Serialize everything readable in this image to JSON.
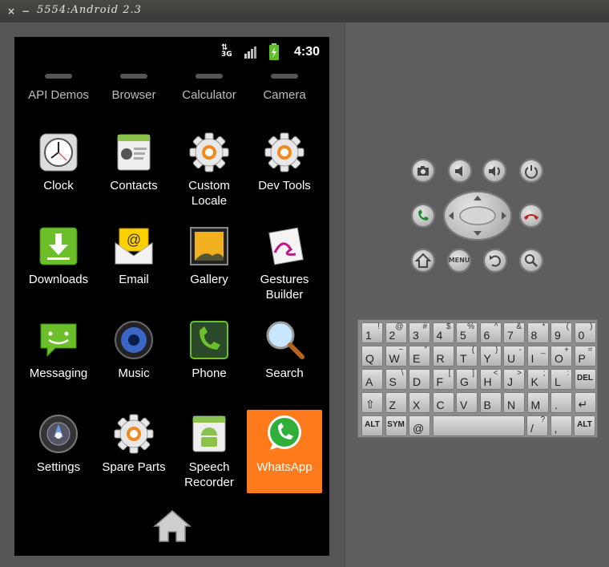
{
  "window": {
    "title": "5554:Android 2.3",
    "close_glyph": "×",
    "min_glyph": "−",
    "max_glyph": "□"
  },
  "status": {
    "time": "4:30",
    "network": "3G"
  },
  "partial_row": [
    "API Demos",
    "Browser",
    "Calculator",
    "Camera"
  ],
  "apps": [
    {
      "label": "Clock",
      "icon": "clock-icon"
    },
    {
      "label": "Contacts",
      "icon": "contacts-icon"
    },
    {
      "label": "Custom\nLocale",
      "icon": "gear-icon"
    },
    {
      "label": "Dev Tools",
      "icon": "gear-icon"
    },
    {
      "label": "Downloads",
      "icon": "download-icon"
    },
    {
      "label": "Email",
      "icon": "email-icon"
    },
    {
      "label": "Gallery",
      "icon": "gallery-icon"
    },
    {
      "label": "Gestures\nBuilder",
      "icon": "gestures-icon"
    },
    {
      "label": "Messaging",
      "icon": "messaging-icon"
    },
    {
      "label": "Music",
      "icon": "music-icon"
    },
    {
      "label": "Phone",
      "icon": "phone-icon"
    },
    {
      "label": "Search",
      "icon": "search-icon"
    },
    {
      "label": "Settings",
      "icon": "settings-icon"
    },
    {
      "label": "Spare Parts",
      "icon": "gear-icon"
    },
    {
      "label": "Speech\nRecorder",
      "icon": "android-icon"
    },
    {
      "label": "WhatsApp",
      "icon": "whatsapp-icon",
      "highlighted": true
    }
  ],
  "dpad": {
    "menu_label": "MENU"
  },
  "keyboard": {
    "rows": [
      [
        [
          "1",
          "!"
        ],
        [
          "2",
          "@"
        ],
        [
          "3",
          "#"
        ],
        [
          "4",
          "$"
        ],
        [
          "5",
          "%"
        ],
        [
          "6",
          "^"
        ],
        [
          "7",
          "&"
        ],
        [
          "8",
          "*"
        ],
        [
          "9",
          "("
        ],
        [
          "0",
          ")"
        ]
      ],
      [
        [
          "Q",
          ""
        ],
        [
          "W",
          "~"
        ],
        [
          "E",
          "\""
        ],
        [
          "R",
          ""
        ],
        [
          "T",
          "{"
        ],
        [
          "Y",
          "}"
        ],
        [
          "U",
          "-"
        ],
        [
          "I",
          "_"
        ],
        [
          "O",
          "+"
        ],
        [
          "P",
          "="
        ]
      ],
      [
        [
          "A",
          ""
        ],
        [
          "S",
          "\\"
        ],
        [
          "D",
          ""
        ],
        [
          "F",
          "["
        ],
        [
          "G",
          "]"
        ],
        [
          "H",
          "<"
        ],
        [
          "J",
          ">"
        ],
        [
          "K",
          ";"
        ],
        [
          "L",
          ":"
        ],
        [
          "DEL",
          ""
        ]
      ],
      [
        [
          "⇧",
          ""
        ],
        [
          "Z",
          ""
        ],
        [
          "X",
          ""
        ],
        [
          "C",
          ""
        ],
        [
          "V",
          ""
        ],
        [
          "B",
          ""
        ],
        [
          "N",
          ""
        ],
        [
          "M",
          ""
        ],
        [
          ".",
          ""
        ],
        [
          "↵",
          ""
        ]
      ]
    ],
    "bottom": {
      "alt": "ALT",
      "sym": "SYM",
      "at": "@",
      "space": "",
      "slash": "/",
      "question": "?",
      "comma": ",",
      "alt2": "ALT"
    }
  }
}
